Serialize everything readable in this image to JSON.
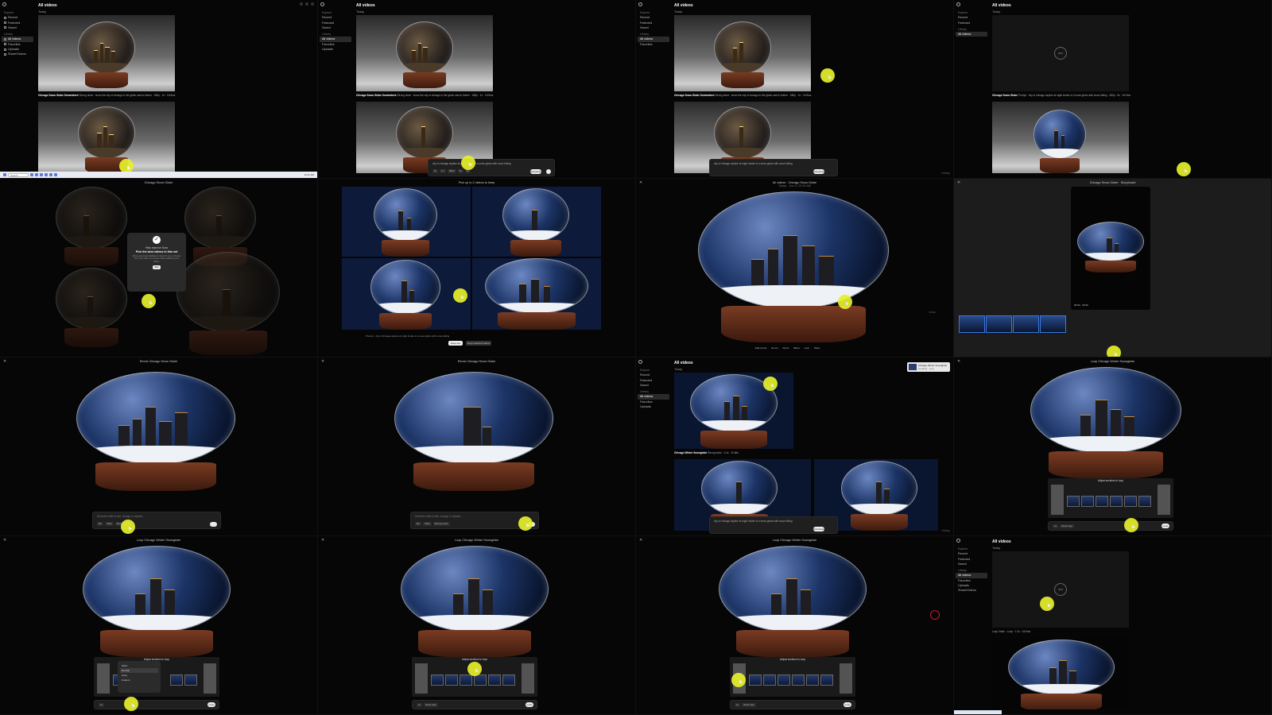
{
  "app": {
    "section_explore": "Explore",
    "explore_items": [
      "Recent",
      "Featured",
      "Saved"
    ],
    "section_library": "Library",
    "library_items": [
      "All videos",
      "Favorites",
      "Uploads",
      "Share/Videos"
    ],
    "title": "All videos",
    "today": "Today"
  },
  "captions": {
    "p1_caption_title": "Chicago Snow Globe Somewhere",
    "p1_caption_desc": "Strong skew · show the city of chicago in the globe cast in theme · 480p · 1s · 16:9ms",
    "p4_caption_title": "Chicago Snow Globe",
    "p4_caption_desc": "Prompt · city of chicago skyline at night inside of a snow globe with snow falling · 480p · 5s · 16:9ms",
    "p11_caption_title": "Chicago Winter Snowglobe",
    "p11_caption_desc": "Strong skew · 1:1s · 10 bits",
    "p16_caption": "Loop Video · Loop · 1:1s · 16:9ms"
  },
  "prompt_bar": {
    "text": "city of chicago skyline at night inside of a snow globe with snow falling",
    "chips": [
      "⚙",
      "1:1",
      "480p",
      "5s",
      "1v"
    ],
    "send": "Storyboard",
    "describe_placeholder": "Describe what to add, change or replace...",
    "remix_chips": [
      "Re",
      "720p",
      "Strong remix"
    ],
    "loop_chips": [
      "1x",
      "Short loop"
    ]
  },
  "taskbar": {
    "search": "Search",
    "time": "10:42 AM"
  },
  "panels": {
    "p5_title": "Chicago Snow Globe",
    "dialog_heading": "Help improve Sora",
    "dialog_title": "Pick the best videos in this set",
    "dialog_body": "We've generated additional videos for you to choose from. Any video you choose will be added to your library.",
    "dialog_button": "Skip",
    "p6_title": "Pick up to 2 videos to keep",
    "p6_prompt": "Prompt · city of chicago skyline at night inside of a snow globe with snow falling",
    "p6_keep": "Keep two",
    "p6_recut": "Keep selected videos",
    "p7_header_title": "All videos · Chicago Snow Globe",
    "p7_header_sub": "Today · Jun 4, 10:24 AM",
    "p7_actions": [
      "Edit prompt",
      "Re-cut",
      "Remix",
      "Blend",
      "Loop",
      "Share"
    ],
    "p7_watermark": "SORA",
    "p8_title": "Chicago Snow Globe · Storyboard",
    "p8_time": "00:00 · 00:20",
    "p9_title": "Remix Chicago Snow Globe",
    "p10_title": "Remix Chicago Snow Globe",
    "p11_toast_title": "Chicago Winter Snowglobe",
    "p11_toast_sub": "Creating · loop",
    "p12_title": "Loop Chicago Winter Snowglobe",
    "strip_header": "Adjust sections to loop",
    "p13_title": "Loop Chicago Winter Snowglobe",
    "p14_title": "Loop Chicago Winter Snowglobe",
    "p15_title": "Loop Chicago Winter Snowglobe",
    "ctx_items": [
      "Short",
      "Normal",
      "Long",
      "Custom"
    ],
    "send_short": "Loop",
    "corner": "Library",
    "loader_pct": "38%",
    "loader_pct2": "45%",
    "loader_pct3": "12%"
  },
  "colors": {
    "background": "#000000",
    "cursor_highlight": "#e6f02a",
    "globe_base": "#7a3b22",
    "globe_sky": "#1c3466"
  },
  "icons": [
    "logo-icon",
    "close-icon",
    "check-icon",
    "loop-icon",
    "send-icon",
    "settings-icon"
  ]
}
